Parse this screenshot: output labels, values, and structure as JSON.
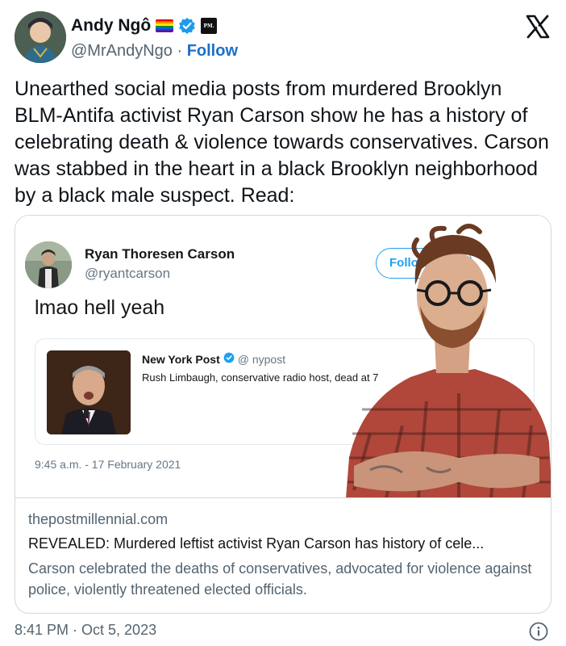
{
  "author": {
    "name": "Andy Ngô",
    "handle": "@MrAndyNgo",
    "separator": " · ",
    "follow_label": "Follow",
    "pm_logo_text": "PM.",
    "verified_color": "#1d9bf0"
  },
  "tweet": {
    "text": "Unearthed social media posts from murdered Brooklyn BLM-Antifa activist Ryan Carson show he has a history of celebrating death & violence towards conservatives. Carson was stabbed in the heart in a black Brooklyn neighborhood by a black male suspect. Read:",
    "timestamp": "8:41 PM · Oct 5, 2023"
  },
  "embedded_tweet": {
    "name": "Ryan Thoresen Carson",
    "handle": "@ryantcarson",
    "follow_label": "Follow",
    "text": "lmao hell yeah",
    "date": "9:45 a.m. - 17 February 2021",
    "quoted": {
      "name": "New York Post",
      "handle": "@ nypost",
      "text": "Rush Limbaugh, conservative radio host, dead at 7"
    }
  },
  "link_card": {
    "domain": "thepostmillennial.com",
    "title": "REVEALED: Murdered leftist activist Ryan Carson has history of cele...",
    "description": "Carson celebrated the deaths of conservatives, advocated for violence against police, violently threatened elected officials."
  },
  "icons": {
    "x_logo": "x-logo-icon",
    "verified": "verified-badge-icon",
    "info": "info-icon"
  }
}
